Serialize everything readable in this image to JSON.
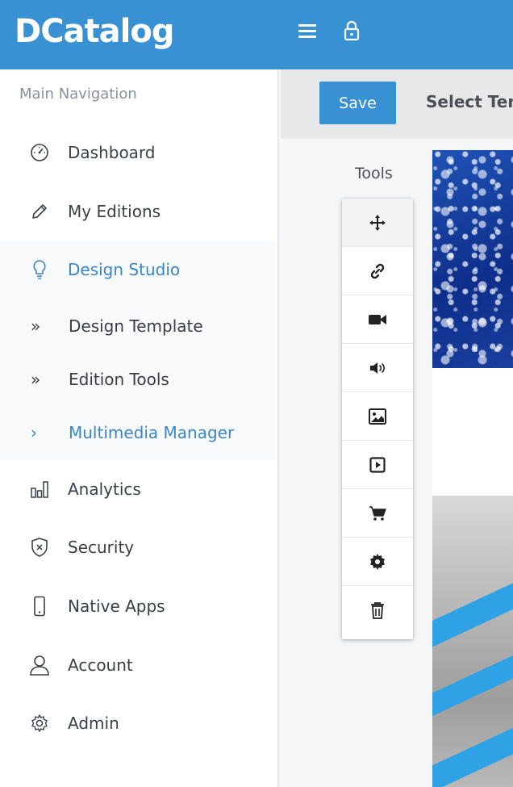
{
  "header": {
    "logo_text": "DCatalog",
    "menu_icon": "hamburger-icon",
    "lock_icon": "lock-icon",
    "accent_color": "#3791d2"
  },
  "sidebar": {
    "heading": "Main Navigation",
    "items": [
      {
        "label": "Dashboard",
        "icon": "dashboard-gauge-icon"
      },
      {
        "label": "My Editions",
        "icon": "pencil-icon"
      },
      {
        "label": "Design Studio",
        "icon": "lightbulb-icon",
        "active": true
      },
      {
        "label": "Analytics",
        "icon": "bar-chart-icon"
      },
      {
        "label": "Security",
        "icon": "shield-icon"
      },
      {
        "label": "Native Apps",
        "icon": "mobile-phone-icon"
      },
      {
        "label": "Account",
        "icon": "user-icon"
      },
      {
        "label": "Admin",
        "icon": "gear-icon"
      }
    ],
    "subitems": [
      {
        "label": "Design Template",
        "icon": "double-chevron-right-icon"
      },
      {
        "label": "Edition Tools",
        "icon": "double-chevron-right-icon"
      },
      {
        "label": "Multimedia Manager",
        "icon": "chevron-right-icon",
        "current": true
      }
    ],
    "active_color": "#3a86c5"
  },
  "toolbar": {
    "save_label": "Save",
    "select_template_label": "Select Temp"
  },
  "tools": {
    "title": "Tools",
    "items": [
      {
        "name": "move-icon"
      },
      {
        "name": "link-icon"
      },
      {
        "name": "video-camera-icon"
      },
      {
        "name": "audio-volume-icon"
      },
      {
        "name": "image-icon"
      },
      {
        "name": "play-slideshow-icon"
      },
      {
        "name": "shopping-cart-icon"
      },
      {
        "name": "settings-gear-icon"
      },
      {
        "name": "trash-icon"
      }
    ]
  }
}
